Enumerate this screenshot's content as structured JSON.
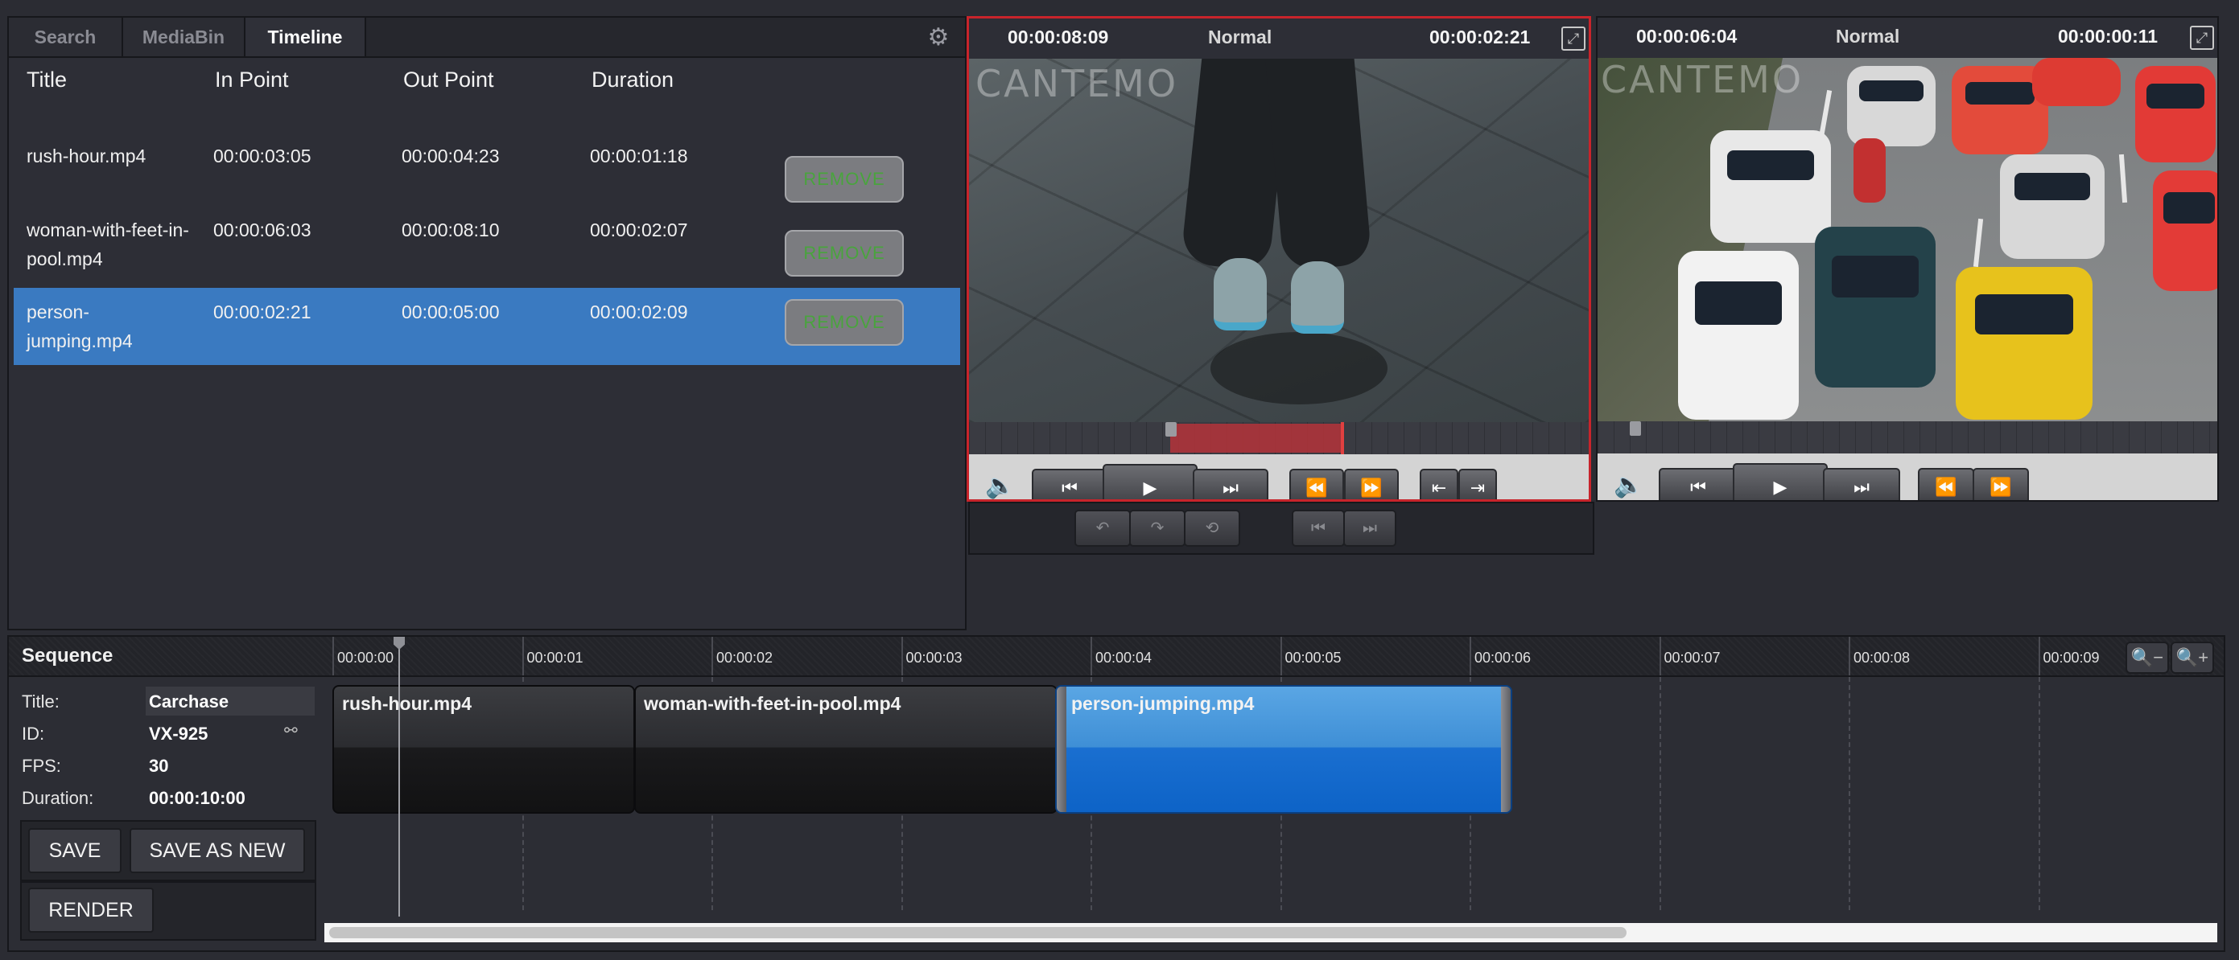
{
  "tabs": [
    {
      "label": "Search"
    },
    {
      "label": "MediaBin"
    },
    {
      "label": "Timeline"
    }
  ],
  "table": {
    "headers": [
      "Title",
      "In Point",
      "Out Point",
      "Duration"
    ],
    "remove_label": "REMOVE",
    "rows": [
      {
        "title": "rush-hour.mp4",
        "title_l2": "",
        "in": "00:00:03:05",
        "out": "00:00:04:23",
        "duration": "00:00:01:18"
      },
      {
        "title": "woman-with-feet-in-",
        "title_l2": "pool.mp4",
        "in": "00:00:06:03",
        "out": "00:00:08:10",
        "duration": "00:00:02:07"
      },
      {
        "title": "person-",
        "title_l2": "jumping.mp4",
        "in": "00:00:02:21",
        "out": "00:00:05:00",
        "duration": "00:00:02:09"
      }
    ]
  },
  "player1": {
    "timecode_left": "00:00:08:09",
    "mode": "Normal",
    "timecode_right": "00:00:02:21",
    "watermark": "CANTEMO"
  },
  "player2": {
    "timecode_left": "00:00:06:04",
    "mode": "Normal",
    "timecode_right": "00:00:00:11",
    "watermark": "CANTEMO"
  },
  "sequence": {
    "header": "Sequence",
    "title_label": "Title:",
    "title_value": "Carchase",
    "id_label": "ID:",
    "id_value": "VX-925",
    "fps_label": "FPS:",
    "fps_value": "30",
    "duration_label": "Duration:",
    "duration_value": "00:00:10:00",
    "save_label": "SAVE",
    "save_as_new_label": "SAVE AS NEW",
    "render_label": "RENDER",
    "ruler": [
      "00:00:00",
      "00:00:01",
      "00:00:02",
      "00:00:03",
      "00:00:04",
      "00:00:05",
      "00:00:06",
      "00:00:07",
      "00:00:08",
      "00:00:09"
    ],
    "clips": [
      {
        "label": "rush-hour.mp4"
      },
      {
        "label": "woman-with-feet-in-pool.mp4"
      },
      {
        "label": "person-jumping.mp4"
      }
    ]
  },
  "colors": {
    "selection": "#3a7ac1",
    "active_player_border": "#c8242b",
    "remove_text": "#49a43d"
  },
  "icons": [
    "gear-icon",
    "volume-icon",
    "step-back-icon",
    "play-icon",
    "step-forward-icon",
    "rewind-icon",
    "fast-forward-icon",
    "mark-in-icon",
    "mark-out-icon",
    "expand-icon",
    "zoom-out-icon",
    "zoom-in-icon",
    "link-icon"
  ]
}
